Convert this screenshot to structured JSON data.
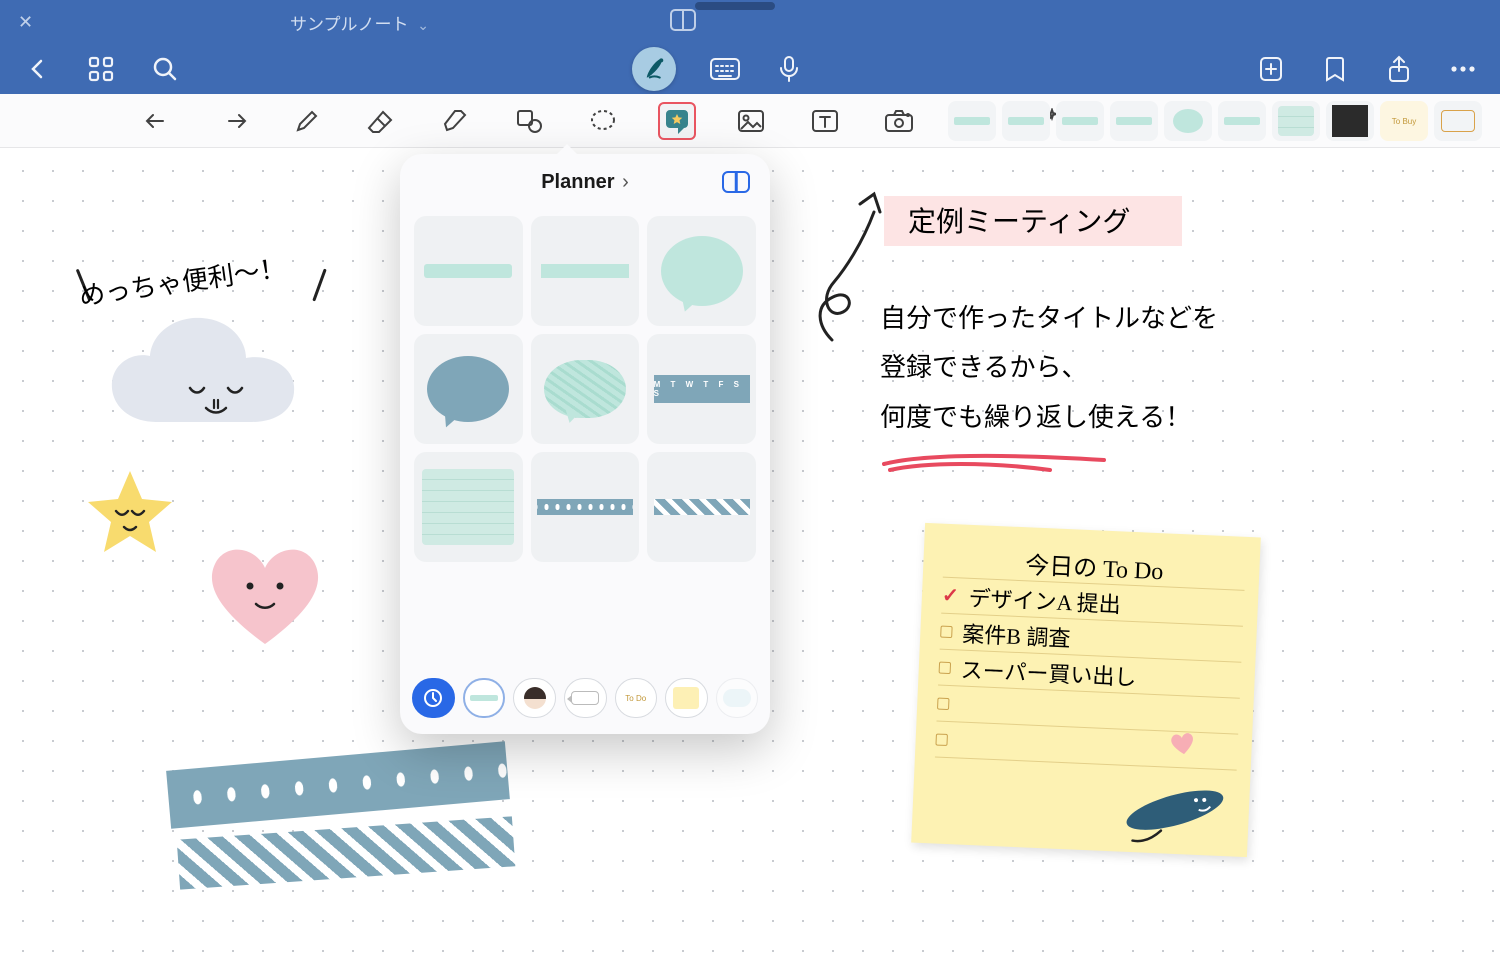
{
  "titlebar": {
    "note_title": "サンプルノート",
    "chevron": "⌄"
  },
  "popover": {
    "collection": "Planner",
    "chevron": "›",
    "week_label": "M T W T F S S",
    "tabs": {
      "todo_label": "To Do"
    }
  },
  "canvas": {
    "title_tape": "定例ミーティング",
    "note_line1": "自分で作ったタイトルなどを",
    "note_line2": "登録できるから、",
    "note_line3": "何度でも繰り返し使える！",
    "exclaim": "めっちゃ便利〜！"
  },
  "sticky": {
    "heading": "今日の To Do",
    "items": [
      {
        "checked": true,
        "text": "デザインA 提出"
      },
      {
        "checked": false,
        "text": "案件B 調査"
      },
      {
        "checked": false,
        "text": "スーパー買い出し"
      }
    ]
  },
  "quickstickers": {
    "todo_label": "To Buy"
  },
  "colors": {
    "brand": "#3f6bb3",
    "mint": "#bfe6dd",
    "slate": "#7fa6b8",
    "accent_red": "#e63946"
  }
}
